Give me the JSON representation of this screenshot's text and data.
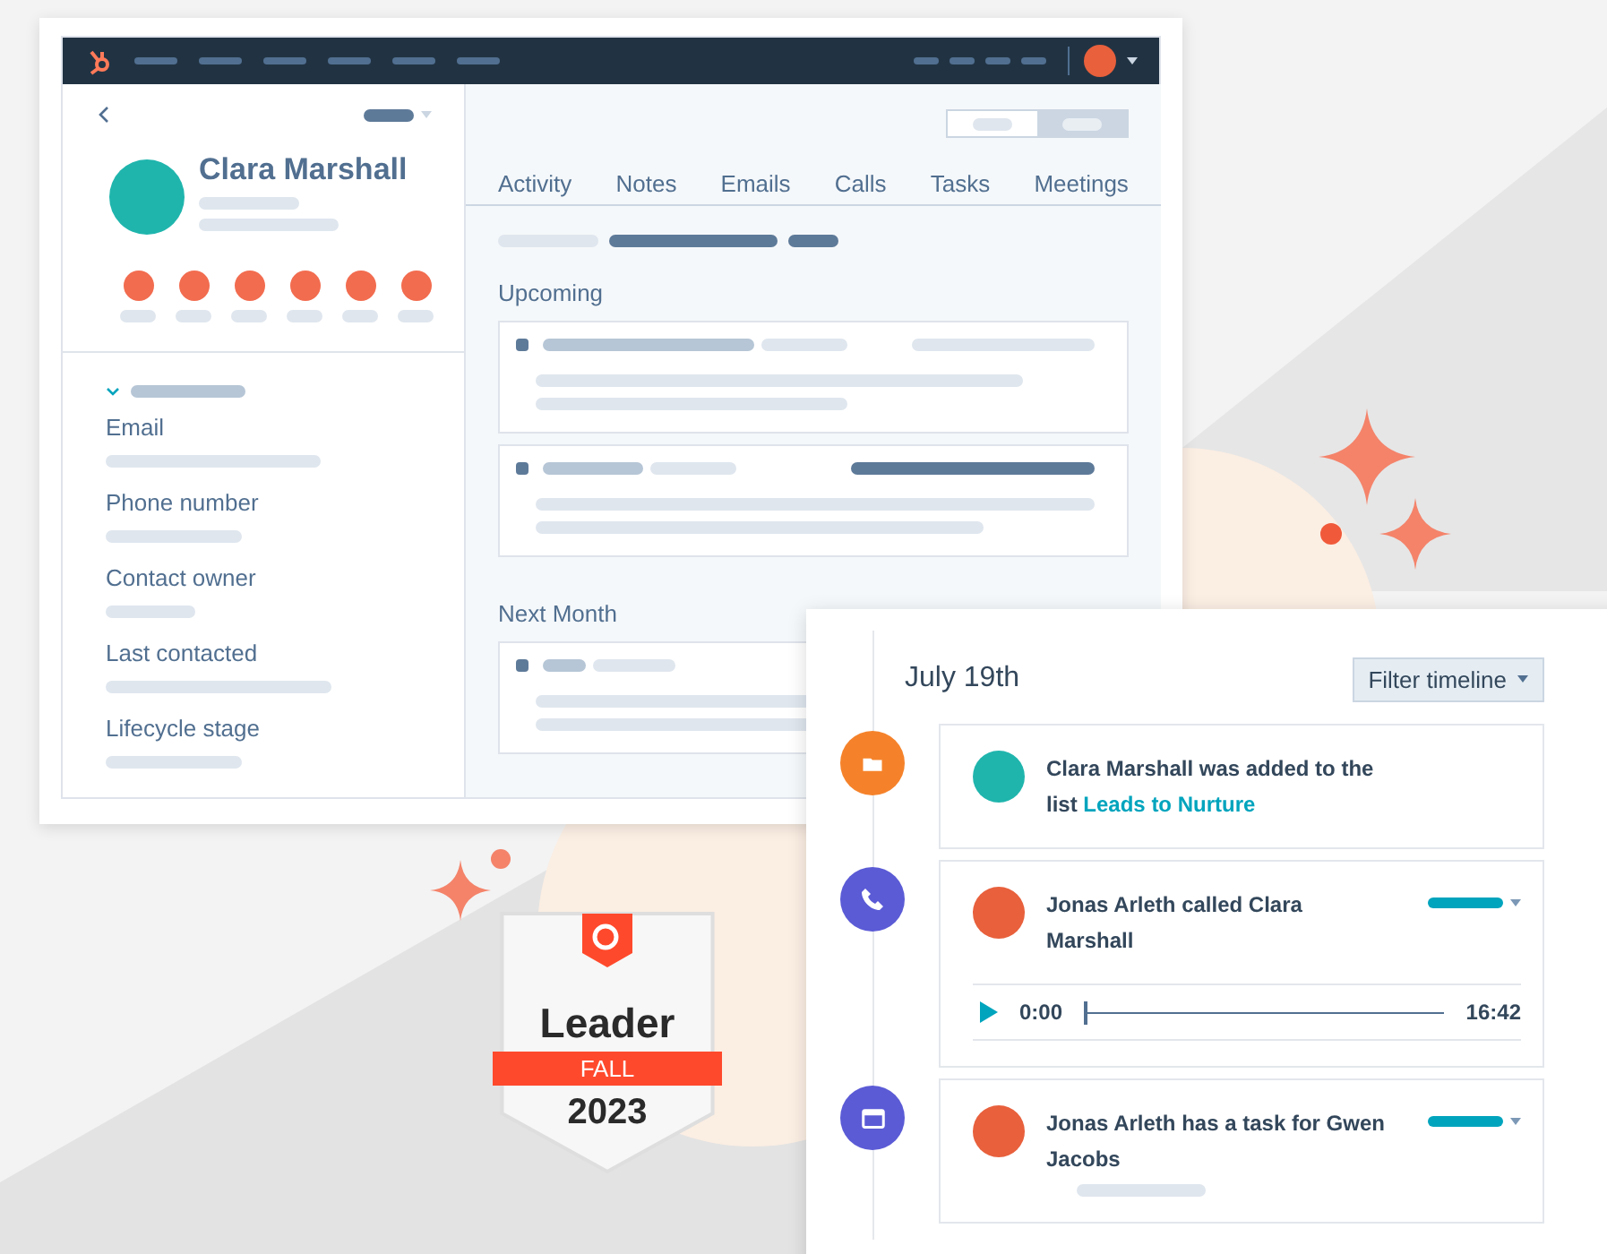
{
  "contact": {
    "name": "Clara Marshall"
  },
  "tabs": [
    {
      "label": "Activity"
    },
    {
      "label": "Notes"
    },
    {
      "label": "Emails"
    },
    {
      "label": "Calls"
    },
    {
      "label": "Tasks"
    },
    {
      "label": "Meetings"
    }
  ],
  "sections": {
    "upcoming": "Upcoming",
    "next_month": "Next Month"
  },
  "properties": [
    {
      "label": "Email"
    },
    {
      "label": "Phone number"
    },
    {
      "label": "Contact owner"
    },
    {
      "label": "Last contacted"
    },
    {
      "label": "Lifecycle stage"
    }
  ],
  "timeline": {
    "date": "July 19th",
    "filter_button": "Filter timeline",
    "events": [
      {
        "kind": "list",
        "color": "#1fb5ad",
        "text": "Clara Marshall was added to the list ",
        "link": "Leads to Nurture"
      },
      {
        "kind": "call",
        "color": "#e8603c",
        "text": "Jonas Arleth called Clara Marshall",
        "start_time": "0:00",
        "duration": "16:42",
        "level": 0
      },
      {
        "kind": "task",
        "color": "#e8603c",
        "text": "Jonas Arleth has a task for Gwen Jacobs"
      }
    ]
  },
  "badge": {
    "title": "Leader",
    "season": "FALL",
    "year": "2023"
  }
}
